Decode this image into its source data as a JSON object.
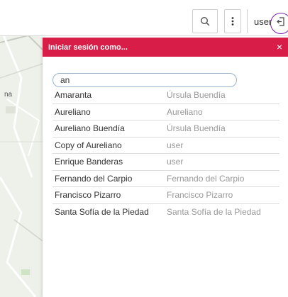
{
  "map": {
    "label": "na"
  },
  "topbar": {
    "search_icon": "search-icon",
    "more_icon": "more-vertical-icon",
    "user_label": "user",
    "logout_icon": "logout-icon"
  },
  "panel": {
    "title": "Iniciar sesión como...",
    "close": "×",
    "search_value": "an",
    "rows": [
      {
        "name": "Amaranta",
        "user": "Úrsula Buendía"
      },
      {
        "name": "Aureliano",
        "user": "Aureliano"
      },
      {
        "name": "Aureliano Buendía",
        "user": "Úrsula Buendía"
      },
      {
        "name": "Copy of Aureliano",
        "user": "user"
      },
      {
        "name": "Enrique Banderas",
        "user": "user"
      },
      {
        "name": "Fernando del Carpio",
        "user": "Fernando del Carpio"
      },
      {
        "name": "Francisco Pizarro",
        "user": "Francisco Pizarro"
      },
      {
        "name": "Santa Sofía de la Piedad",
        "user": "Santa Sofía de la Piedad"
      }
    ]
  },
  "colors": {
    "accent": "#d81d48",
    "focus_ring": "#7a1fb0"
  }
}
